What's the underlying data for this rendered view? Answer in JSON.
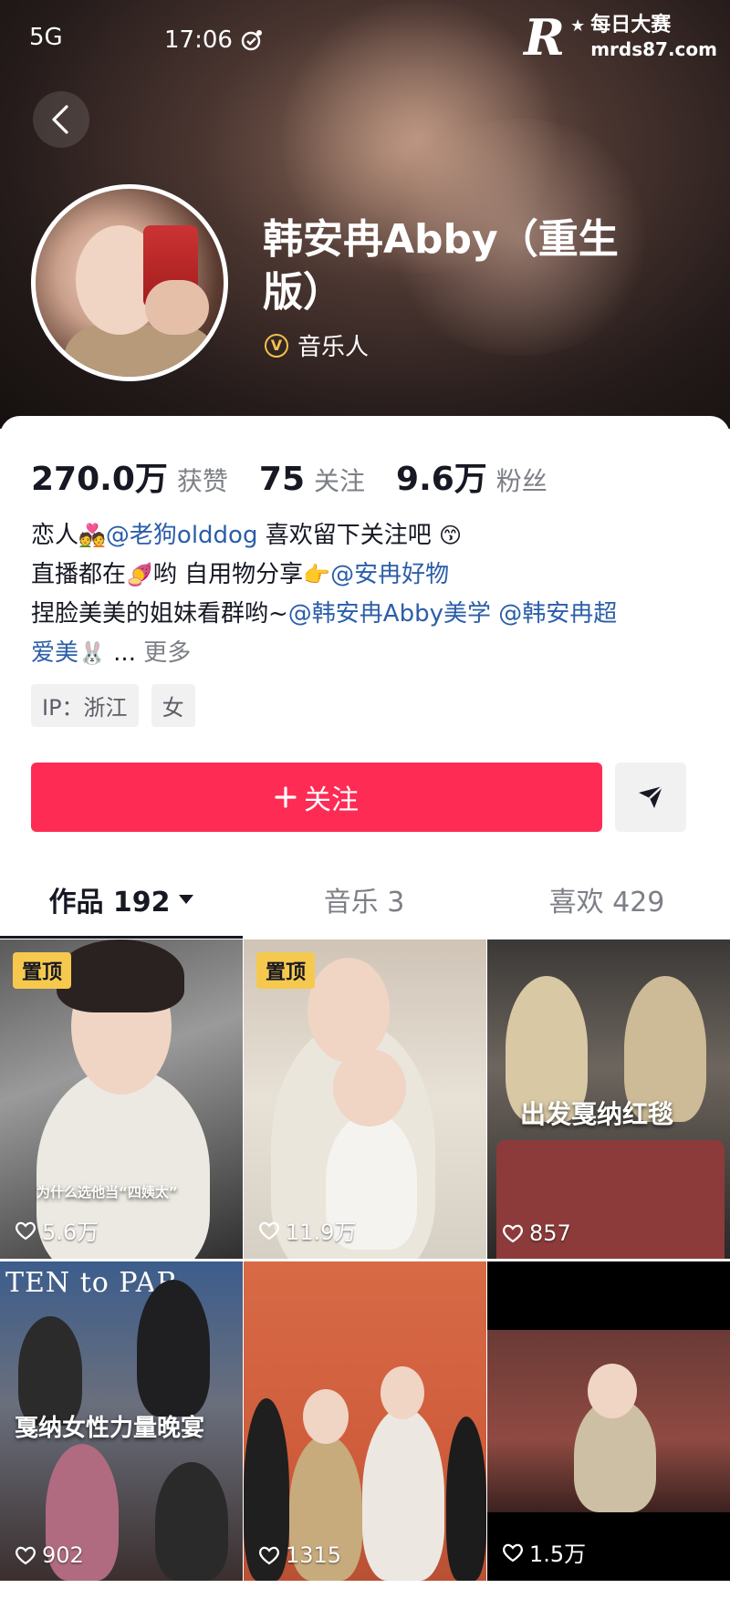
{
  "status_bar": {
    "signal": "5G",
    "time": "17:06"
  },
  "watermark": {
    "logo": "R",
    "title": "每日大赛",
    "site": "mrds87.com"
  },
  "profile": {
    "name": "韩安冉Abby（重生版）",
    "role": "音乐人",
    "stats": [
      {
        "value": "270.0万",
        "label": "获赞"
      },
      {
        "value": "75",
        "label": "关注"
      },
      {
        "value": "9.6万",
        "label": "粉丝"
      }
    ],
    "bio": {
      "line1_pre": "恋人",
      "line1_emoji": "💑",
      "line1_mention": "@老狗olddog",
      "line1_post": " 喜欢留下关注吧 ",
      "line1_emoji2": "😙",
      "line2_pre": "直播都在",
      "line2_emoji": "🍠",
      "line2_mid": "哟 自用物分享",
      "line2_emoji2": "👉",
      "line2_mention": "@安冉好物",
      "line3_pre": "捏脸美美的姐妹看群哟~",
      "line3_mention1": "@韩安冉Abby美学",
      "line3_mention2": " @韩安冉超",
      "line4_mention": "爱美",
      "line4_emoji": "🐰",
      "line4_ellipsis": " ... ",
      "more": "更多"
    },
    "tags": [
      "IP：浙江",
      "女"
    ],
    "follow_label": "关注"
  },
  "tabs": [
    {
      "label": "作品 192",
      "active": true
    },
    {
      "label": "音乐 3",
      "active": false
    },
    {
      "label": "喜欢 429",
      "active": false
    }
  ],
  "videos": [
    {
      "pinned": "置顶",
      "likes": "5.6万",
      "caption": "为什么选他当“四姨太”"
    },
    {
      "pinned": "置顶",
      "likes": "11.9万",
      "caption": ""
    },
    {
      "pinned": "",
      "likes": "857",
      "caption": "出发戛纳红毯"
    },
    {
      "pinned": "",
      "likes": "902",
      "caption": "戛纳女性力量晚宴",
      "banner": "TEN to PAR"
    },
    {
      "pinned": "",
      "likes": "1315",
      "caption": ""
    },
    {
      "pinned": "",
      "likes": "1.5万",
      "caption": ""
    }
  ],
  "colors": {
    "accent": "#fe2c55",
    "mention": "#2b5ea8",
    "pin": "#f6c94e"
  }
}
